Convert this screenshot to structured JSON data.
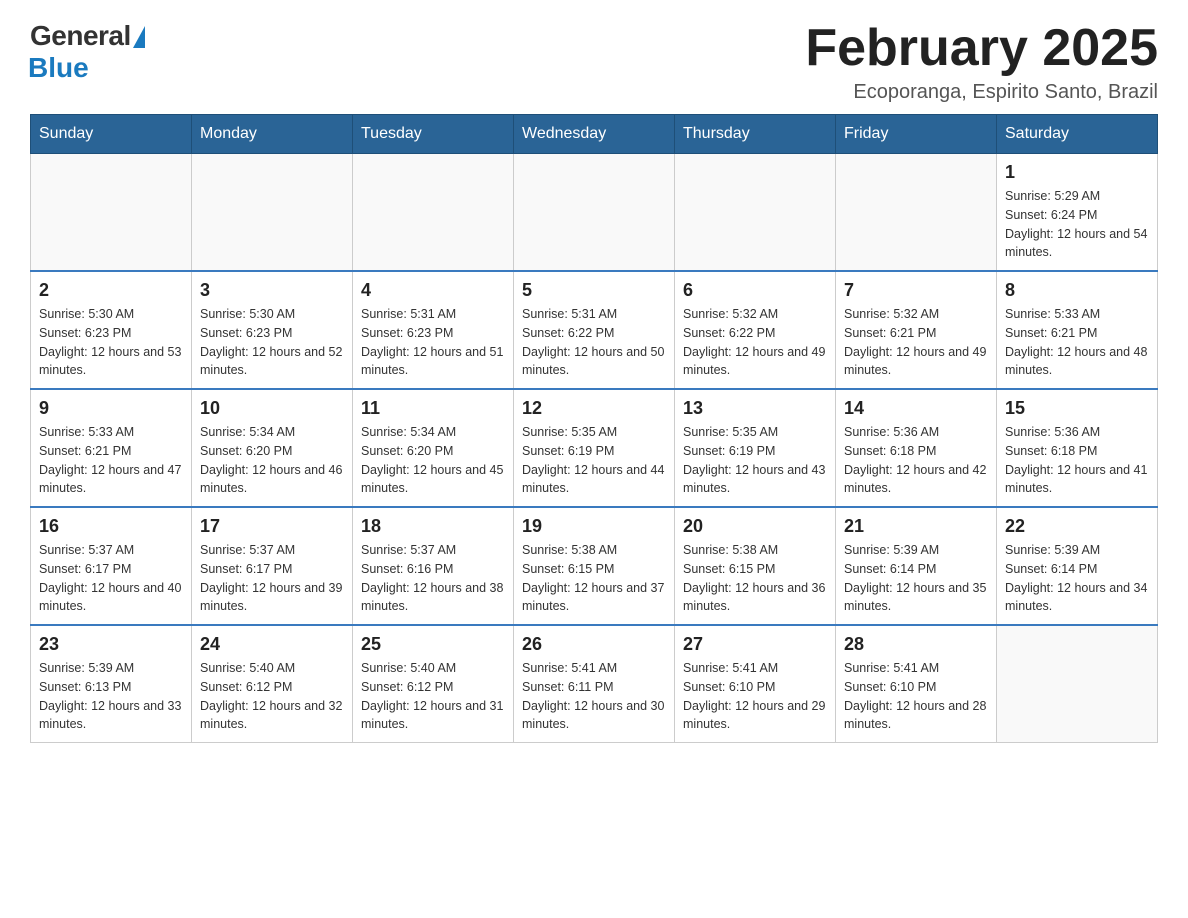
{
  "logo": {
    "general": "General",
    "blue": "Blue"
  },
  "header": {
    "title": "February 2025",
    "subtitle": "Ecoporanga, Espirito Santo, Brazil"
  },
  "days_of_week": [
    "Sunday",
    "Monday",
    "Tuesday",
    "Wednesday",
    "Thursday",
    "Friday",
    "Saturday"
  ],
  "weeks": [
    [
      {
        "day": "",
        "info": ""
      },
      {
        "day": "",
        "info": ""
      },
      {
        "day": "",
        "info": ""
      },
      {
        "day": "",
        "info": ""
      },
      {
        "day": "",
        "info": ""
      },
      {
        "day": "",
        "info": ""
      },
      {
        "day": "1",
        "info": "Sunrise: 5:29 AM\nSunset: 6:24 PM\nDaylight: 12 hours and 54 minutes."
      }
    ],
    [
      {
        "day": "2",
        "info": "Sunrise: 5:30 AM\nSunset: 6:23 PM\nDaylight: 12 hours and 53 minutes."
      },
      {
        "day": "3",
        "info": "Sunrise: 5:30 AM\nSunset: 6:23 PM\nDaylight: 12 hours and 52 minutes."
      },
      {
        "day": "4",
        "info": "Sunrise: 5:31 AM\nSunset: 6:23 PM\nDaylight: 12 hours and 51 minutes."
      },
      {
        "day": "5",
        "info": "Sunrise: 5:31 AM\nSunset: 6:22 PM\nDaylight: 12 hours and 50 minutes."
      },
      {
        "day": "6",
        "info": "Sunrise: 5:32 AM\nSunset: 6:22 PM\nDaylight: 12 hours and 49 minutes."
      },
      {
        "day": "7",
        "info": "Sunrise: 5:32 AM\nSunset: 6:21 PM\nDaylight: 12 hours and 49 minutes."
      },
      {
        "day": "8",
        "info": "Sunrise: 5:33 AM\nSunset: 6:21 PM\nDaylight: 12 hours and 48 minutes."
      }
    ],
    [
      {
        "day": "9",
        "info": "Sunrise: 5:33 AM\nSunset: 6:21 PM\nDaylight: 12 hours and 47 minutes."
      },
      {
        "day": "10",
        "info": "Sunrise: 5:34 AM\nSunset: 6:20 PM\nDaylight: 12 hours and 46 minutes."
      },
      {
        "day": "11",
        "info": "Sunrise: 5:34 AM\nSunset: 6:20 PM\nDaylight: 12 hours and 45 minutes."
      },
      {
        "day": "12",
        "info": "Sunrise: 5:35 AM\nSunset: 6:19 PM\nDaylight: 12 hours and 44 minutes."
      },
      {
        "day": "13",
        "info": "Sunrise: 5:35 AM\nSunset: 6:19 PM\nDaylight: 12 hours and 43 minutes."
      },
      {
        "day": "14",
        "info": "Sunrise: 5:36 AM\nSunset: 6:18 PM\nDaylight: 12 hours and 42 minutes."
      },
      {
        "day": "15",
        "info": "Sunrise: 5:36 AM\nSunset: 6:18 PM\nDaylight: 12 hours and 41 minutes."
      }
    ],
    [
      {
        "day": "16",
        "info": "Sunrise: 5:37 AM\nSunset: 6:17 PM\nDaylight: 12 hours and 40 minutes."
      },
      {
        "day": "17",
        "info": "Sunrise: 5:37 AM\nSunset: 6:17 PM\nDaylight: 12 hours and 39 minutes."
      },
      {
        "day": "18",
        "info": "Sunrise: 5:37 AM\nSunset: 6:16 PM\nDaylight: 12 hours and 38 minutes."
      },
      {
        "day": "19",
        "info": "Sunrise: 5:38 AM\nSunset: 6:15 PM\nDaylight: 12 hours and 37 minutes."
      },
      {
        "day": "20",
        "info": "Sunrise: 5:38 AM\nSunset: 6:15 PM\nDaylight: 12 hours and 36 minutes."
      },
      {
        "day": "21",
        "info": "Sunrise: 5:39 AM\nSunset: 6:14 PM\nDaylight: 12 hours and 35 minutes."
      },
      {
        "day": "22",
        "info": "Sunrise: 5:39 AM\nSunset: 6:14 PM\nDaylight: 12 hours and 34 minutes."
      }
    ],
    [
      {
        "day": "23",
        "info": "Sunrise: 5:39 AM\nSunset: 6:13 PM\nDaylight: 12 hours and 33 minutes."
      },
      {
        "day": "24",
        "info": "Sunrise: 5:40 AM\nSunset: 6:12 PM\nDaylight: 12 hours and 32 minutes."
      },
      {
        "day": "25",
        "info": "Sunrise: 5:40 AM\nSunset: 6:12 PM\nDaylight: 12 hours and 31 minutes."
      },
      {
        "day": "26",
        "info": "Sunrise: 5:41 AM\nSunset: 6:11 PM\nDaylight: 12 hours and 30 minutes."
      },
      {
        "day": "27",
        "info": "Sunrise: 5:41 AM\nSunset: 6:10 PM\nDaylight: 12 hours and 29 minutes."
      },
      {
        "day": "28",
        "info": "Sunrise: 5:41 AM\nSunset: 6:10 PM\nDaylight: 12 hours and 28 minutes."
      },
      {
        "day": "",
        "info": ""
      }
    ]
  ]
}
